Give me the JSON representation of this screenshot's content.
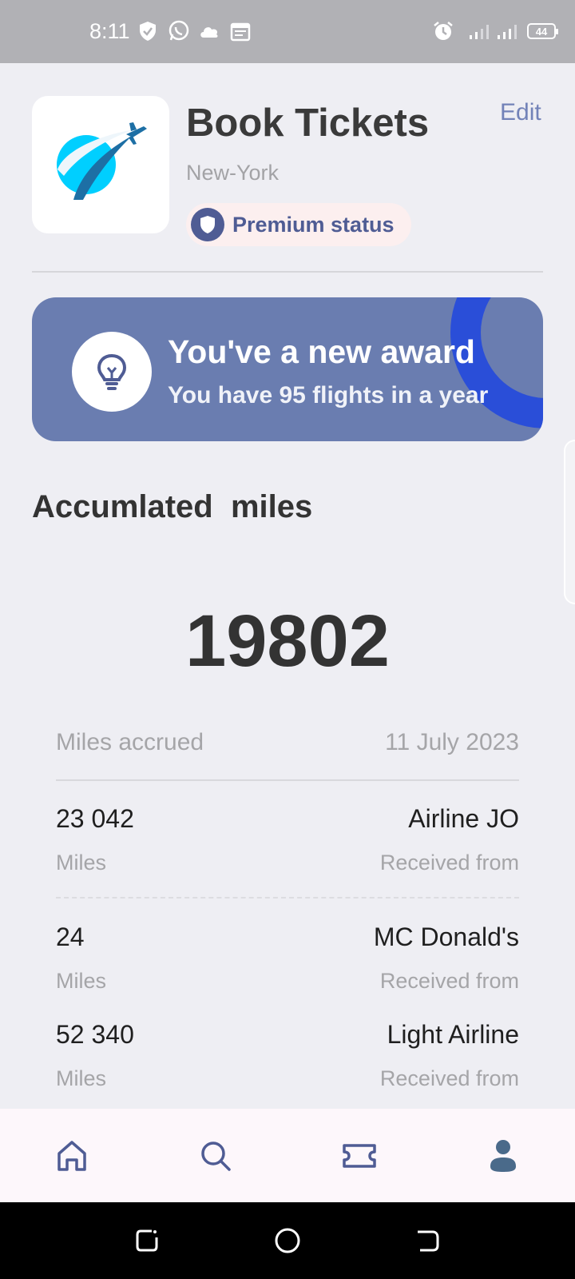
{
  "status_bar": {
    "time": "8:11",
    "battery": "44"
  },
  "header": {
    "title": "Book Tickets",
    "location": "New-York",
    "edit_label": "Edit",
    "premium_label": "Premium status"
  },
  "award": {
    "title": "You've a new award",
    "subtitle": "You have 95 flights in a year"
  },
  "miles": {
    "section_title": "Accumlated  miles",
    "total": "19802",
    "accrued_label": "Miles accrued",
    "date": "11 July 2023",
    "entries": [
      {
        "amount": "23 042",
        "unit": "Miles",
        "source": "Airline JO",
        "source_label": "Received from"
      },
      {
        "amount": "24",
        "unit": "Miles",
        "source": "MC Donald's",
        "source_label": "Received from"
      },
      {
        "amount": "52 340",
        "unit": "Miles",
        "source": "Light Airline",
        "source_label": "Received from"
      }
    ]
  },
  "bottom_nav": {
    "items": [
      "home-icon",
      "search-icon",
      "ticket-icon",
      "profile-icon"
    ],
    "active": "profile-icon"
  },
  "colors": {
    "accent": "#4f5c94",
    "banner": "#6a7db0",
    "ring": "#2a4ed8",
    "background": "#eeeef3"
  }
}
